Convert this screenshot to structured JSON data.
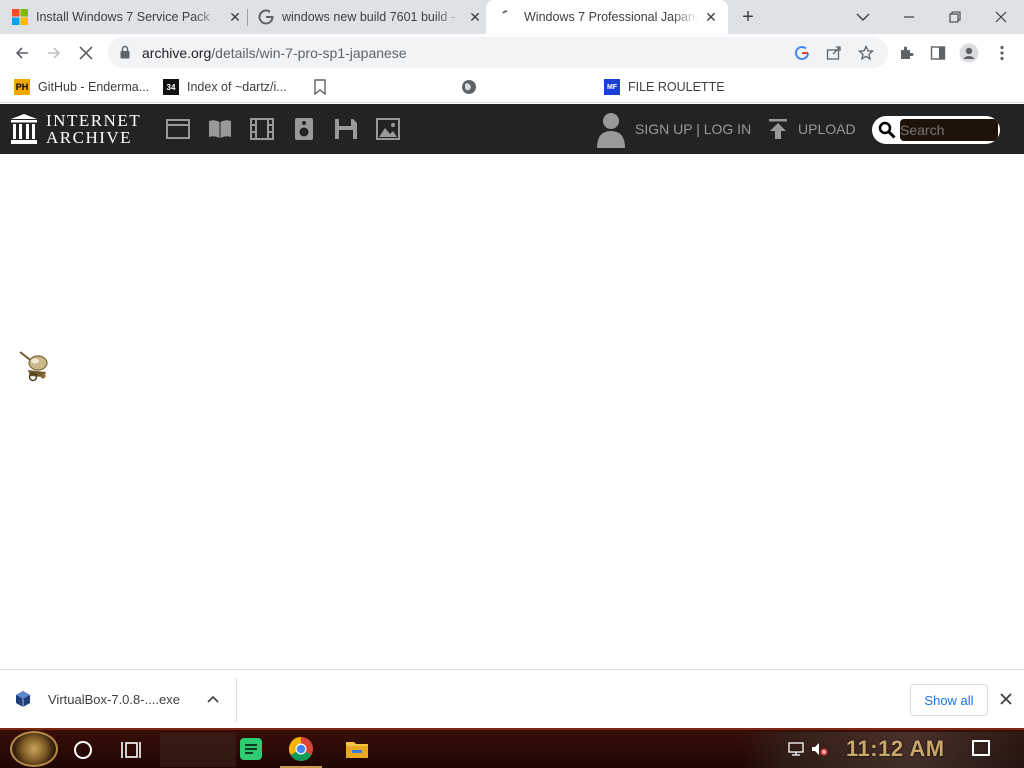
{
  "tabs": [
    {
      "title": "Install Windows 7 Service Pack",
      "favicon": "windows-logo-icon",
      "active": false
    },
    {
      "title": "windows new build 7601 build -",
      "favicon": "google-icon",
      "active": false
    },
    {
      "title": "Windows 7 Professional Japanese",
      "favicon": "loading-spinner-icon",
      "active": true
    }
  ],
  "toolbar": {
    "url_domain": "archive.org",
    "url_path": "/details/win-7-pro-sp1-japanese"
  },
  "bookmarks": [
    {
      "label": "GitHub - Enderma...",
      "icon": "ph-icon",
      "icon_text": "PH"
    },
    {
      "label": "Index of ~dartz/i...",
      "icon": "index-icon",
      "icon_text": "34"
    },
    {
      "label": "",
      "icon": "bookmark-icon",
      "icon_text": ""
    },
    {
      "label": "",
      "icon": "globe-icon",
      "icon_text": ""
    },
    {
      "label": "FILE ROULETTE",
      "icon": "file-roulette-icon",
      "icon_text": "MF"
    }
  ],
  "archive": {
    "wordmark_line1": "INTERNET",
    "wordmark_line2": "ARCHIVE",
    "signup": "SIGN UP | LOG IN",
    "upload": "UPLOAD",
    "search_placeholder": "Search"
  },
  "download": {
    "filename": "VirtualBox-7.0.8-....exe",
    "show_all": "Show all"
  },
  "taskbar": {
    "clock": "11:12 AM"
  },
  "colors": {
    "ia_header": "#232323",
    "link_blue": "#1a73e8",
    "taskbar": "#2a0a06",
    "clock": "#c9a66b"
  }
}
